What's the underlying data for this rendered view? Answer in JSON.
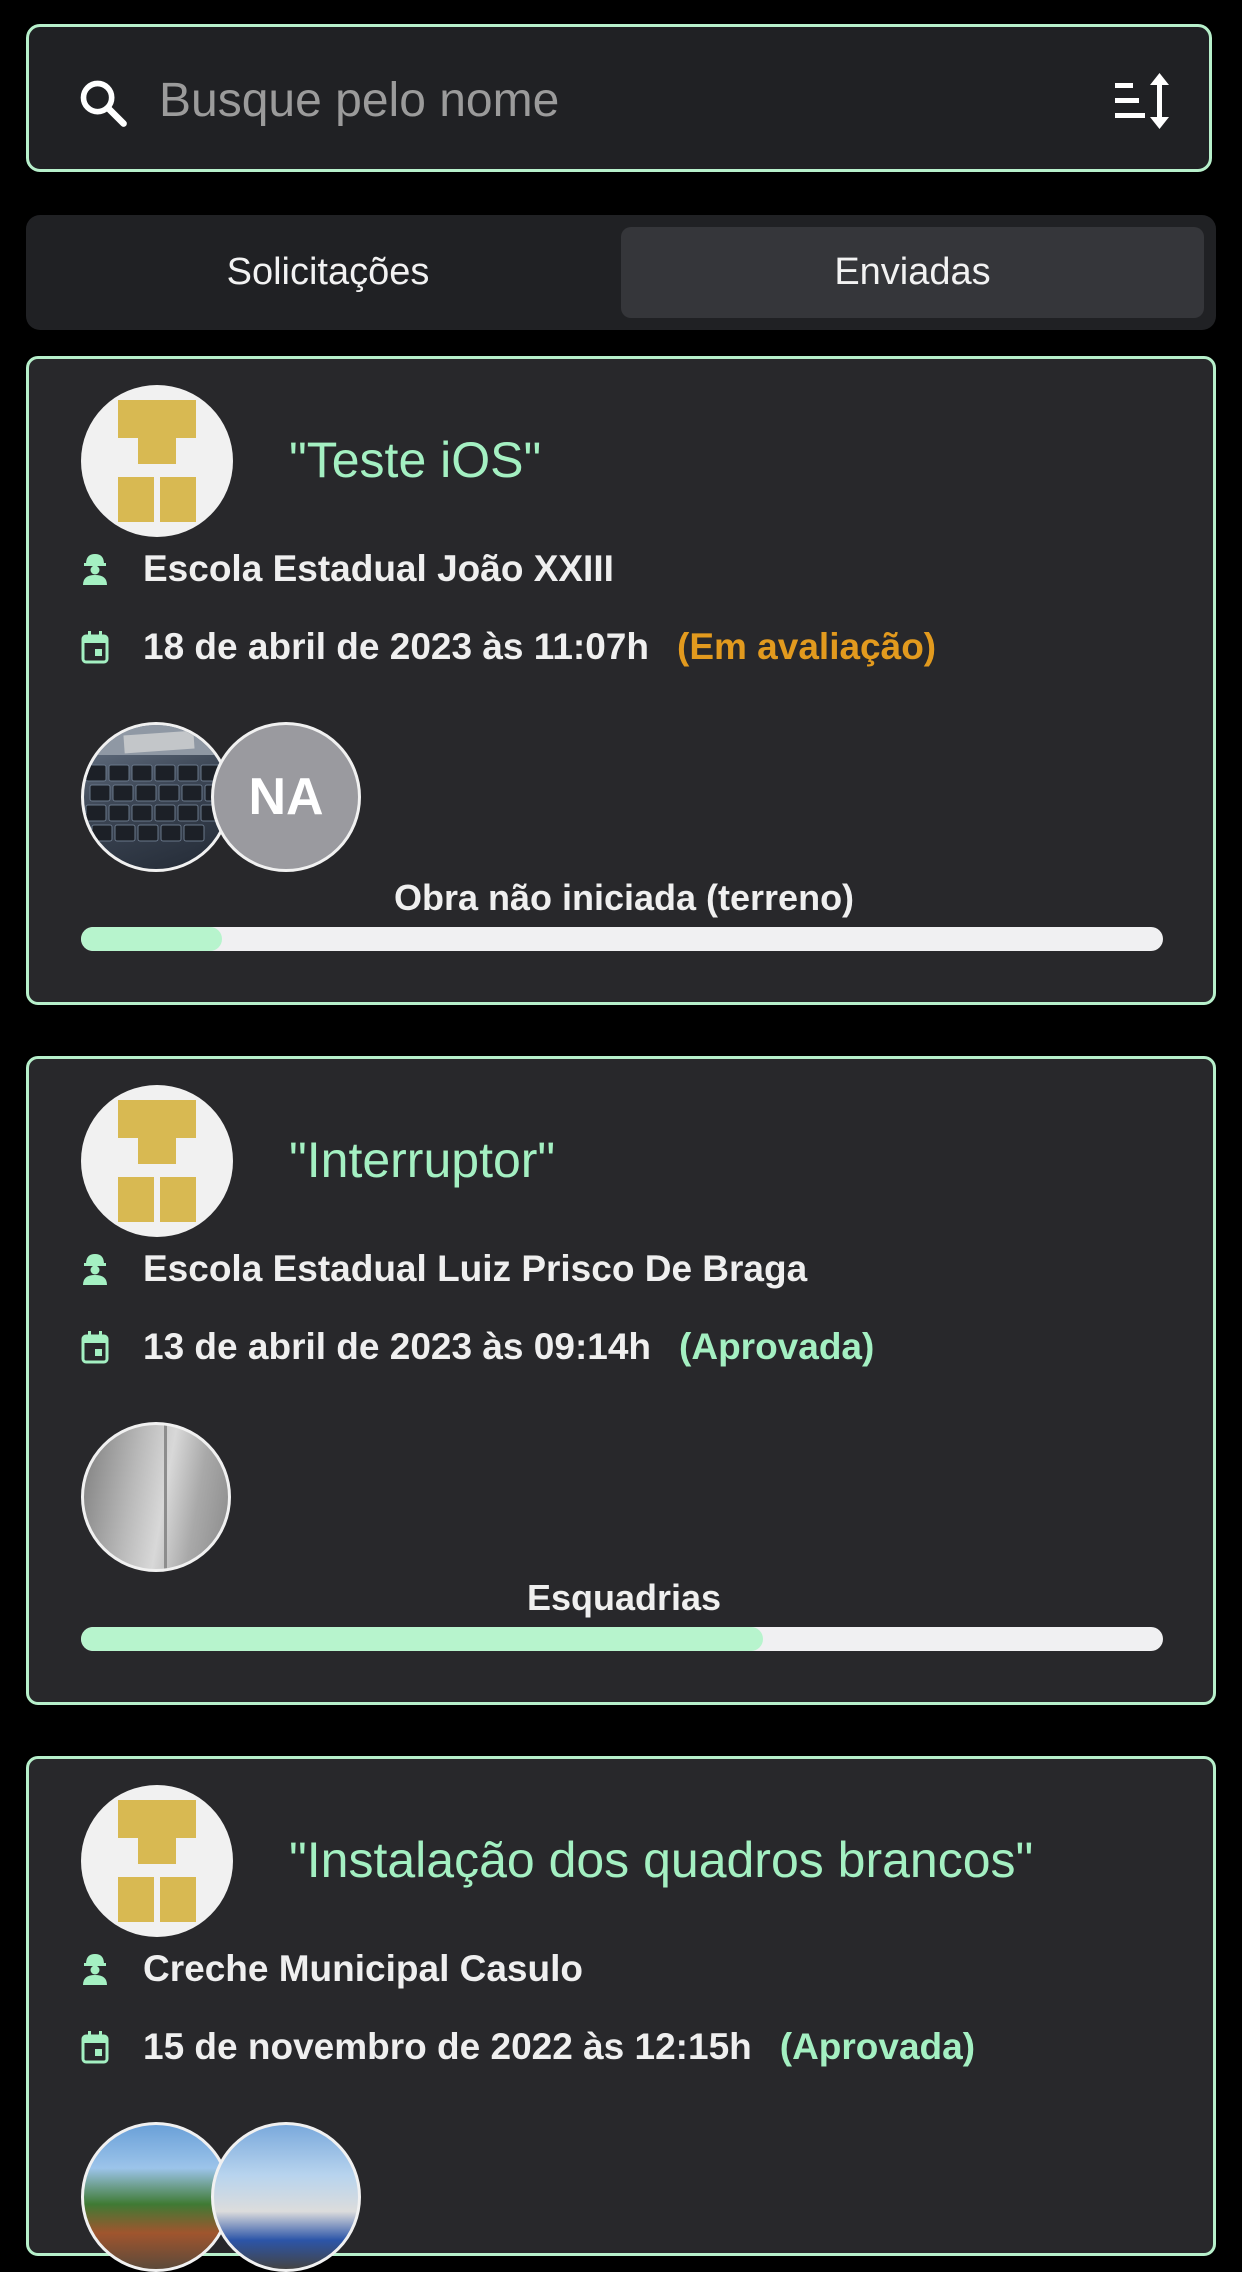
{
  "search": {
    "placeholder": "Busque pelo nome"
  },
  "tabs": [
    {
      "label": "Solicitações",
      "selected": false
    },
    {
      "label": "Enviadas",
      "selected": true
    }
  ],
  "cards": [
    {
      "title": "\"Teste iOS\"",
      "school": "Escola Estadual João XXIII",
      "date": "18 de abril de 2023 às 11:07h",
      "status": "(Em avaliação)",
      "avatar_initials": "NA",
      "progress_label": "Obra não iniciada (terreno)",
      "progress": 0.13
    },
    {
      "title": "\"Interruptor\"",
      "school": "Escola Estadual Luiz Prisco De Braga",
      "date": "13 de abril de 2023 às 09:14h",
      "status": "(Aprovada)",
      "progress_label": "Esquadrias",
      "progress": 0.63
    },
    {
      "title": "\"Instalação dos quadros brancos\"",
      "school": "Creche Municipal Casulo",
      "date": "15 de novembro de 2022 às 12:15h",
      "status": "(Aprovada)"
    }
  ],
  "colors": {
    "accent": "#b7f0cb",
    "pending": "#e29a1e",
    "approved": "#a4f0c2"
  }
}
